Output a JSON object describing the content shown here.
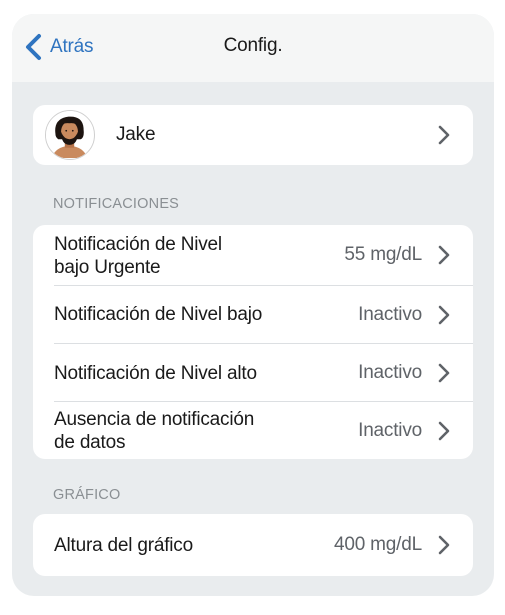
{
  "nav": {
    "back_label": "Atrás",
    "title": "Config."
  },
  "profile": {
    "name": "Jake"
  },
  "notifications": {
    "header": "NOTIFICACIONES",
    "rows": [
      {
        "label_line1": "Notificación de Nivel",
        "label_line2": "bajo Urgente",
        "value": "55 mg/dL"
      },
      {
        "label_line1": "Notificación de Nivel bajo",
        "label_line2": "",
        "value": "Inactivo"
      },
      {
        "label_line1": "Notificación de Nivel alto",
        "label_line2": "",
        "value": "Inactivo"
      },
      {
        "label_line1": "Ausencia de notificación",
        "label_line2": "de datos",
        "value": "Inactivo"
      }
    ]
  },
  "graph": {
    "header": "GRÁFICO",
    "rows": [
      {
        "label": "Altura del gráfico",
        "value": "400 mg/dL"
      }
    ]
  },
  "colors": {
    "accent": "#2f74c0",
    "background": "#e9ecee",
    "card": "#ffffff",
    "secondary_text": "#5f6368",
    "section_header": "#8a8f93"
  }
}
